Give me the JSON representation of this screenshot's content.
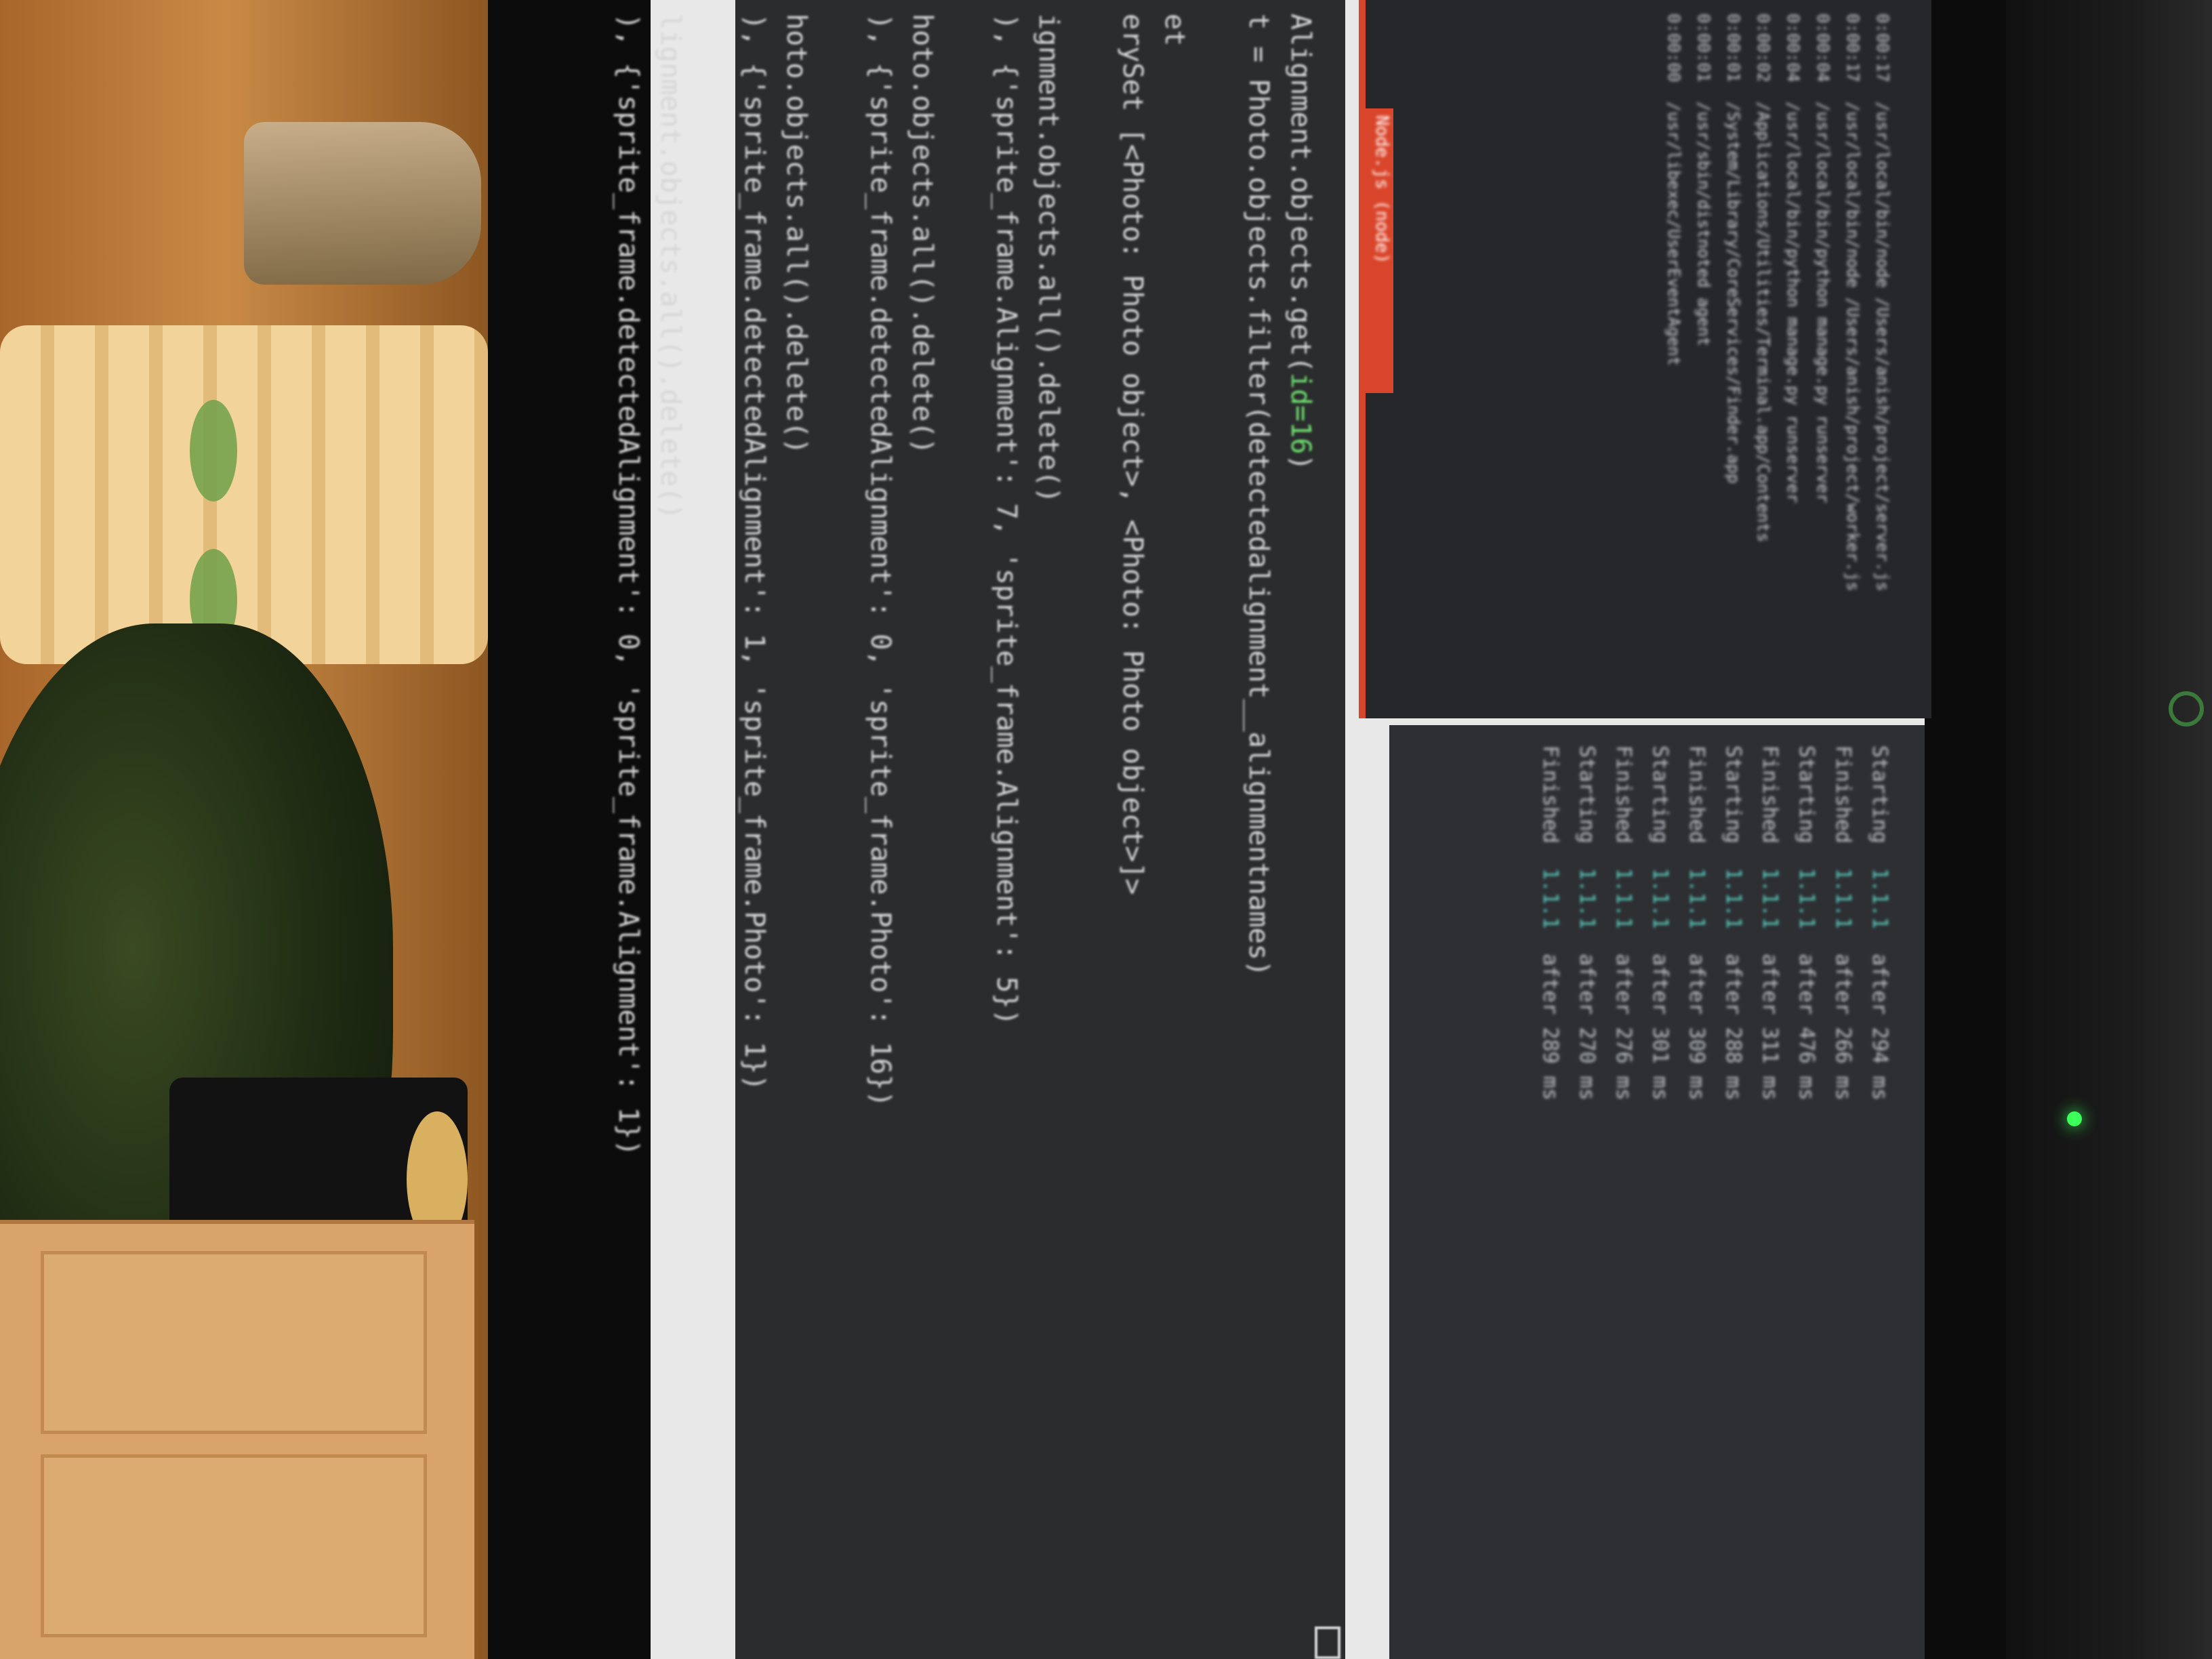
{
  "terminal": {
    "code_lines": [
      {
        "text": "Alignment.objects.get(",
        "highlight": "id=16",
        "tail": ")"
      },
      {
        "text": "t = Photo.objects.filter(detectedalignment__alignmentnames)"
      },
      {
        "text": ""
      },
      {
        "text": "et"
      },
      {
        "text": "erySet [<Photo: Photo object>, <Photo: Photo object>]>"
      },
      {
        "text": ""
      },
      {
        "text": "ignment.objects.all().delete()"
      },
      {
        "text": "), {'sprite_frame.Alignment': 7, 'sprite_frame.Alignment': 5})"
      },
      {
        "text": ""
      },
      {
        "text": "hoto.objects.all().delete()"
      },
      {
        "text": "), {'sprite_frame.detectedAlignment': 0, 'sprite_frame.Photo': 16})"
      },
      {
        "text": ""
      },
      {
        "text": "hoto.objects.all().delete()"
      },
      {
        "text": "), {'sprite_frame.detectedAlignment': 1, 'sprite_frame.Photo': 1})"
      },
      {
        "text": ""
      },
      {
        "text": "lignment.objects.all().delete()"
      },
      {
        "text": "), {'sprite_frame.detectedAlignment': 0, 'sprite_frame.Alignment': 1})"
      }
    ],
    "log_lines": [
      {
        "label": "Starting",
        "tag": "1.1.1",
        "msg": "after 294 ms"
      },
      {
        "label": "Finished",
        "tag": "1.1.1",
        "msg": "after 266 ms"
      },
      {
        "label": "Starting",
        "tag": "1.1.1",
        "msg": "after 476 ms"
      },
      {
        "label": "Finished",
        "tag": "1.1.1",
        "msg": "after 311 ms"
      },
      {
        "label": "Starting",
        "tag": "1.1.1",
        "msg": "after 288 ms"
      },
      {
        "label": "Finished",
        "tag": "1.1.1",
        "msg": "after 309 ms"
      },
      {
        "label": "Starting",
        "tag": "1.1.1",
        "msg": "after 301 ms"
      },
      {
        "label": "Finished",
        "tag": "1.1.1",
        "msg": "after 276 ms"
      },
      {
        "label": "Starting",
        "tag": "1.1.1",
        "msg": "after 270 ms"
      },
      {
        "label": "Finished",
        "tag": "1.1.1",
        "msg": "after 289 ms"
      }
    ],
    "ps_header": "Node.js (node)",
    "ps_lines": [
      "0:00:17  /usr/local/bin/node /Users/anish/project/server.js",
      "0:00:17  /usr/local/bin/node /Users/anish/project/worker.js",
      "0:00:04  /usr/local/bin/python manage.py runserver",
      "0:00:04  /usr/local/bin/python manage.py runserver",
      "0:00:02  /Applications/Utilities/Terminal.app/Contents",
      "0:00:01  /System/Library/CoreServices/Finder.app",
      "0:00:01  /usr/sbin/distnoted agent",
      "0:00:00  /usr/libexec/UserEventAgent"
    ]
  },
  "colors": {
    "highlight": "#6ee06e",
    "accent": "#5ad0c0",
    "ps_header_bg": "#d9452a"
  }
}
